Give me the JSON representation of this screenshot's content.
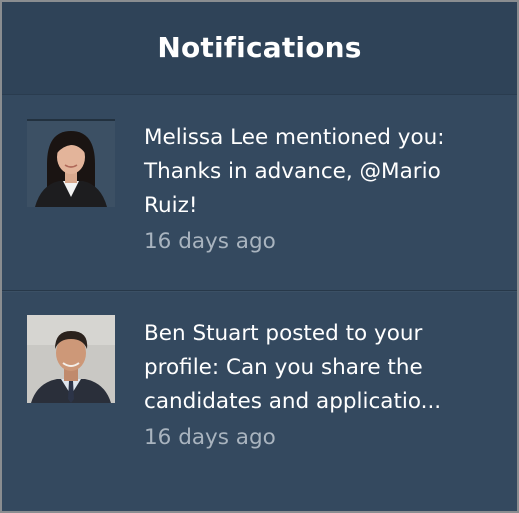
{
  "header": {
    "title": "Notifications"
  },
  "notifications": [
    {
      "lines": [
        "Melissa Lee mentioned you:",
        "Thanks in advance, @Mario",
        "Ruiz!"
      ],
      "time": "16 days ago",
      "avatar_icon": "person-avatar-woman"
    },
    {
      "lines": [
        "Ben Stuart posted to your",
        "profile: Can you share the",
        "candidates and applicatio..."
      ],
      "time": "16 days ago",
      "avatar_icon": "person-avatar-man"
    }
  ],
  "colors": {
    "panel_bg": "#34495f",
    "header_bg": "#2f4358",
    "text_primary": "#ffffff",
    "text_secondary": "#a9b4bf"
  }
}
